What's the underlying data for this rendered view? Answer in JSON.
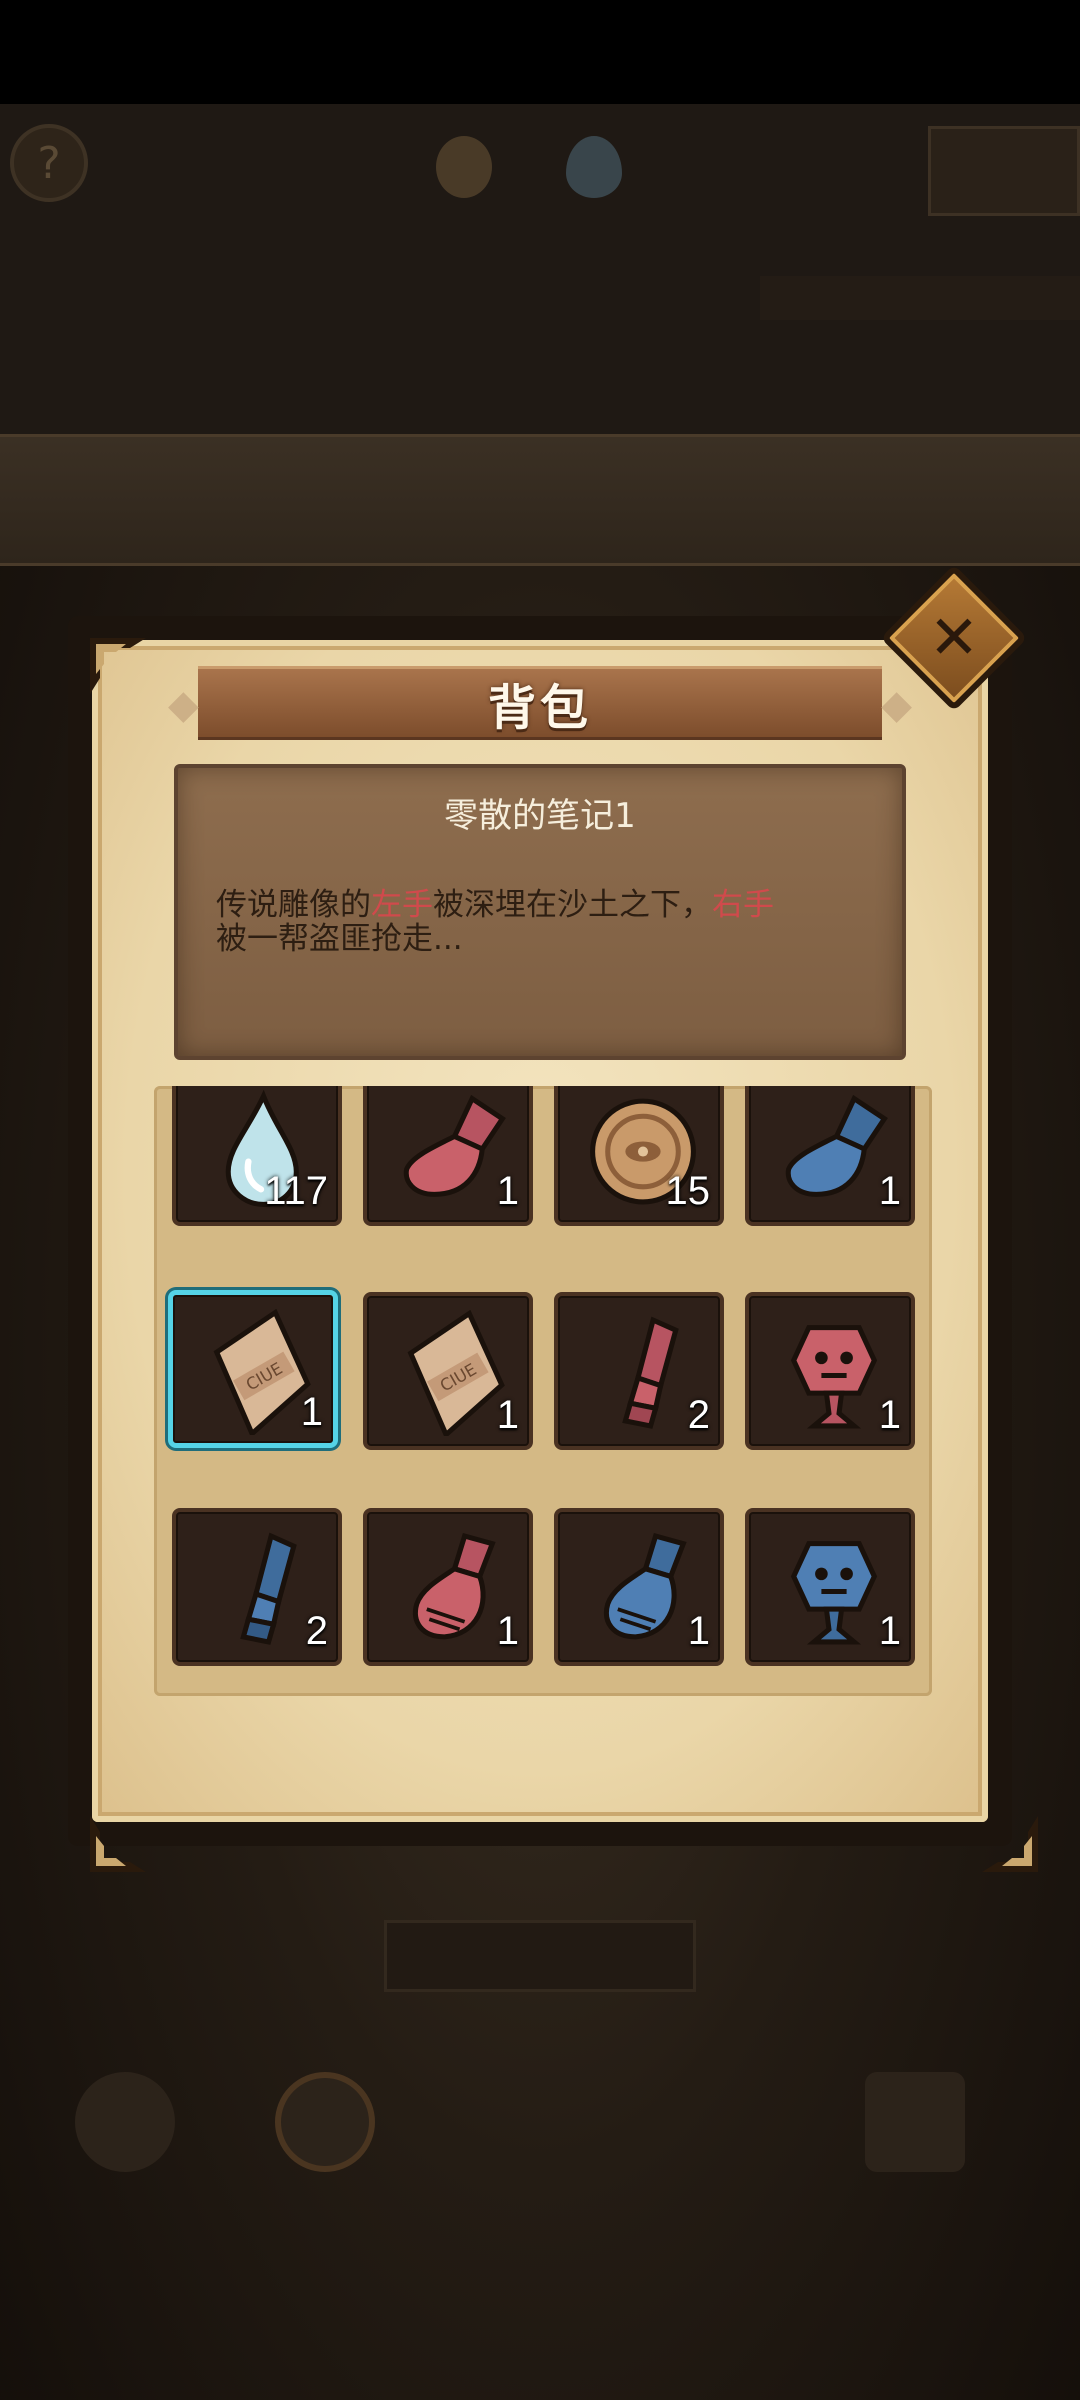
{
  "panel": {
    "title": "背包",
    "close_label": "✕"
  },
  "item_detail": {
    "name": "零散的笔记1",
    "description_parts": [
      "传说雕像的",
      "左手",
      "被深埋在沙土之下，",
      "右手",
      "被一帮盗匪抢走..."
    ],
    "highlight_color": "#d04a4c"
  },
  "inventory": {
    "selected_index": 4,
    "slots": [
      {
        "item": "water-drop-icon",
        "count": "117"
      },
      {
        "item": "red-hand-part-icon",
        "count": "1"
      },
      {
        "item": "bronze-coin-icon",
        "count": "15"
      },
      {
        "item": "blue-hand-part-icon",
        "count": "1"
      },
      {
        "item": "clue-note-icon",
        "count": "1"
      },
      {
        "item": "clue-note-icon",
        "count": "1"
      },
      {
        "item": "red-arm-part-icon",
        "count": "2"
      },
      {
        "item": "red-statue-head-icon",
        "count": "1"
      },
      {
        "item": "blue-arm-part-icon",
        "count": "2"
      },
      {
        "item": "red-hand-part-icon",
        "count": "1"
      },
      {
        "item": "blue-hand-part-icon",
        "count": "1"
      },
      {
        "item": "blue-statue-head-icon",
        "count": "1"
      }
    ]
  },
  "colors": {
    "selection_outline": "#55d3e6",
    "red_part": "#c9616a",
    "blue_part": "#4f7fb4"
  }
}
